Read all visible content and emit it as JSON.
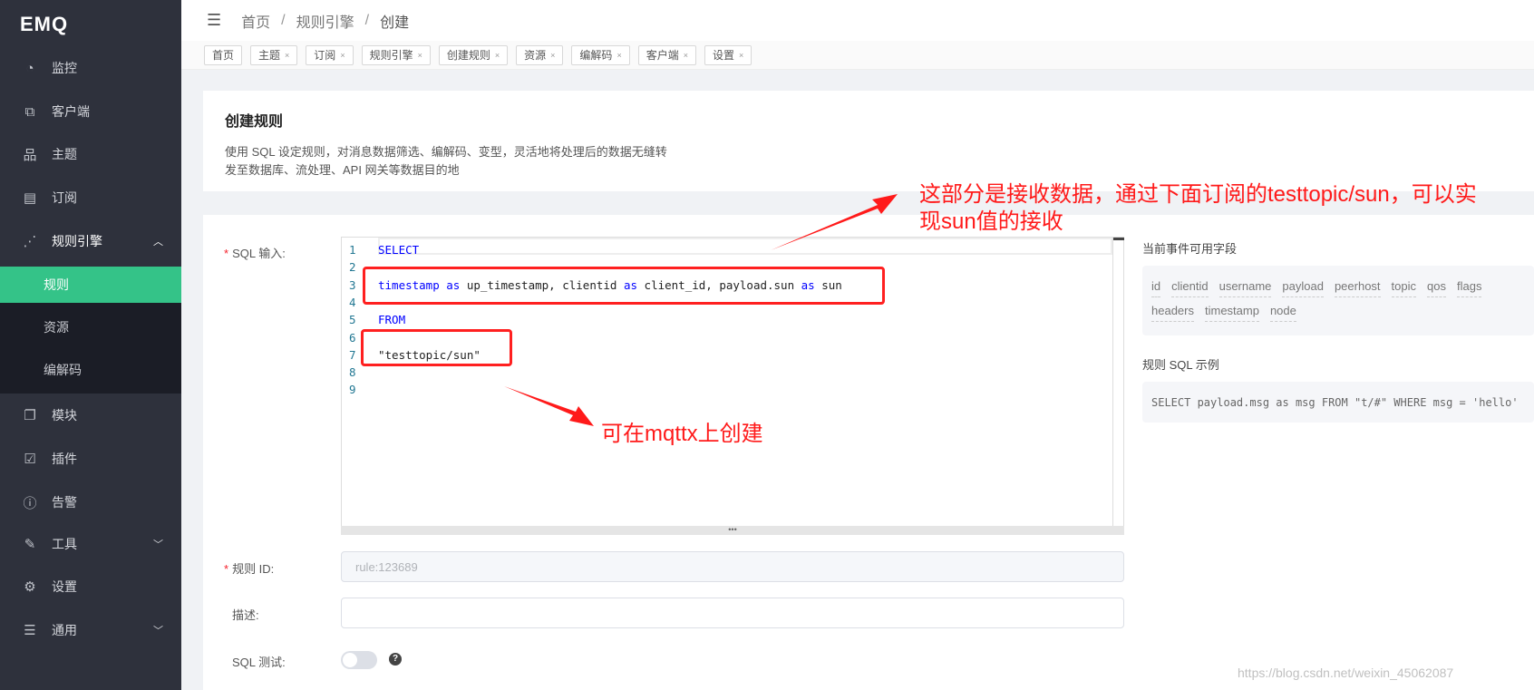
{
  "sidebar": {
    "logo": "EMQ",
    "items": [
      {
        "label": "监控",
        "icon": "dashboard-icon"
      },
      {
        "label": "客户端",
        "icon": "clients-icon"
      },
      {
        "label": "主题",
        "icon": "topic-tree-icon"
      },
      {
        "label": "订阅",
        "icon": "subscription-icon"
      },
      {
        "label": "规则引擎",
        "icon": "rule-engine-icon",
        "expanded": true
      },
      {
        "label": "模块",
        "icon": "modules-icon"
      },
      {
        "label": "插件",
        "icon": "plugins-icon"
      },
      {
        "label": "告警",
        "icon": "alarm-icon"
      },
      {
        "label": "工具",
        "icon": "tools-icon"
      },
      {
        "label": "设置",
        "icon": "settings-icon"
      },
      {
        "label": "通用",
        "icon": "general-icon"
      }
    ],
    "subitems": [
      {
        "label": "规则",
        "active": true
      },
      {
        "label": "资源"
      },
      {
        "label": "编解码"
      }
    ],
    "active_color": "#34c388"
  },
  "header": {
    "breadcrumb": [
      "首页",
      "规则引擎",
      "创建"
    ]
  },
  "tags": [
    "首页",
    "主题",
    "订阅",
    "规则引擎",
    "创建规则",
    "资源",
    "编解码",
    "客户端",
    "设置"
  ],
  "intro": {
    "title": "创建规则",
    "description": "使用 SQL 设定规则，对消息数据筛选、编解码、变型，灵活地将处理后的数据无缝转发至数据库、流处理、API 网关等数据目的地"
  },
  "form": {
    "sql_label": "SQL 输入:",
    "sql_lines": [
      {
        "n": "1",
        "parts": [
          {
            "t": "SELECT",
            "kw": true
          }
        ]
      },
      {
        "n": "2",
        "parts": []
      },
      {
        "n": "3",
        "parts": [
          {
            "t": "timestamp",
            "kw": true
          },
          {
            "t": " "
          },
          {
            "t": "as",
            "kw": true
          },
          {
            "t": " up_timestamp, clientid "
          },
          {
            "t": "as",
            "kw": true
          },
          {
            "t": " client_id, payload.sun "
          },
          {
            "t": "as",
            "kw": true
          },
          {
            "t": " sun"
          }
        ]
      },
      {
        "n": "4",
        "parts": []
      },
      {
        "n": "5",
        "parts": [
          {
            "t": "FROM",
            "kw": true
          }
        ]
      },
      {
        "n": "6",
        "parts": []
      },
      {
        "n": "7",
        "parts": [
          {
            "t": "\"testtopic/sun\""
          }
        ]
      },
      {
        "n": "8",
        "parts": []
      },
      {
        "n": "9",
        "parts": []
      }
    ],
    "rule_id_label": "规则 ID:",
    "rule_id_placeholder": "rule:123689",
    "desc_label": "描述:",
    "desc_value": "",
    "sql_test_label": "SQL 测试:",
    "sql_test_enabled": false,
    "help_icon": "question-circle-icon"
  },
  "right": {
    "fields_title": "当前事件可用字段",
    "fields": [
      "id",
      "clientid",
      "username",
      "payload",
      "peerhost",
      "topic",
      "qos",
      "flags",
      "headers",
      "timestamp",
      "node"
    ],
    "example_title": "规则 SQL 示例",
    "example": "SELECT payload.msg as msg FROM \"t/#\" WHERE msg = 'hello'"
  },
  "annotations": {
    "note1_line1": "这部分是接收数据，通过下面订阅的testtopic/sun，可以实",
    "note1_line2": "现sun值的接收",
    "note2": "可在mqttx上创建",
    "color": "#ff1a1a"
  },
  "watermark": "https://blog.csdn.net/weixin_45062087"
}
